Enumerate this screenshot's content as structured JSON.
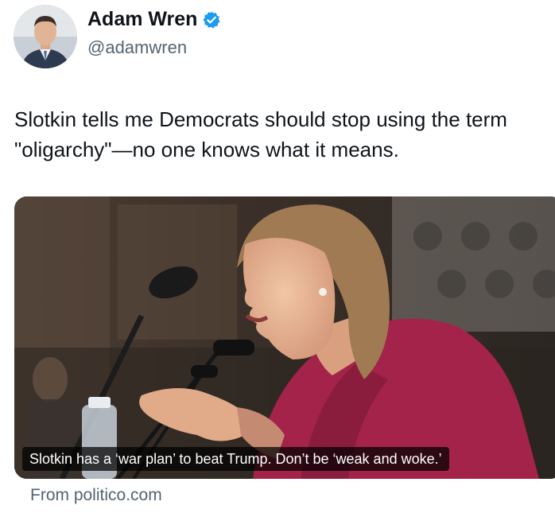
{
  "author": {
    "display_name": "Adam Wren",
    "handle": "@adamwren",
    "verified": true,
    "avatar_icon": "profile-photo",
    "verified_icon": "verified-badge-icon"
  },
  "tweet": {
    "text": "Slotkin tells me Democrats should stop using the term \"oligarchy\"—no one knows what it means."
  },
  "link_card": {
    "headline": "Slotkin has a ‘war plan’ to beat Trump. Don’t be ‘weak and woke.’",
    "source": "From politico.com"
  },
  "colors": {
    "text": "#0f1419",
    "secondary": "#536471",
    "verified": "#1d9bf0"
  }
}
